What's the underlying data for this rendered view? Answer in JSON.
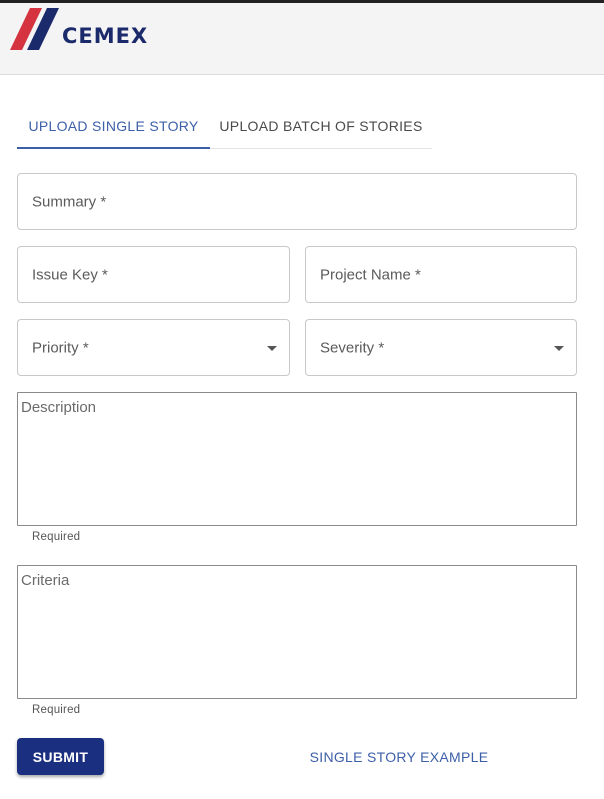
{
  "header": {
    "brand": "CEMEX",
    "logo_colors": {
      "red": "#d4333f",
      "navy": "#1b2a6b"
    }
  },
  "tabs": [
    {
      "label": "UPLOAD SINGLE STORY",
      "active": true
    },
    {
      "label": "UPLOAD BATCH OF STORIES",
      "active": false
    }
  ],
  "form": {
    "summary": {
      "placeholder": "Summary *"
    },
    "issue_key": {
      "placeholder": "Issue Key *"
    },
    "project_name": {
      "placeholder": "Project Name *"
    },
    "priority": {
      "placeholder": "Priority *"
    },
    "severity": {
      "placeholder": "Severity *"
    },
    "description": {
      "placeholder": "Description",
      "helper": "Required"
    },
    "criteria": {
      "placeholder": "Criteria",
      "helper": "Required"
    }
  },
  "actions": {
    "submit_label": "SUBMIT",
    "example_label": "SINGLE STORY EXAMPLE"
  },
  "colors": {
    "accent": "#3d5fa8",
    "primary_button": "#1b2f80"
  }
}
